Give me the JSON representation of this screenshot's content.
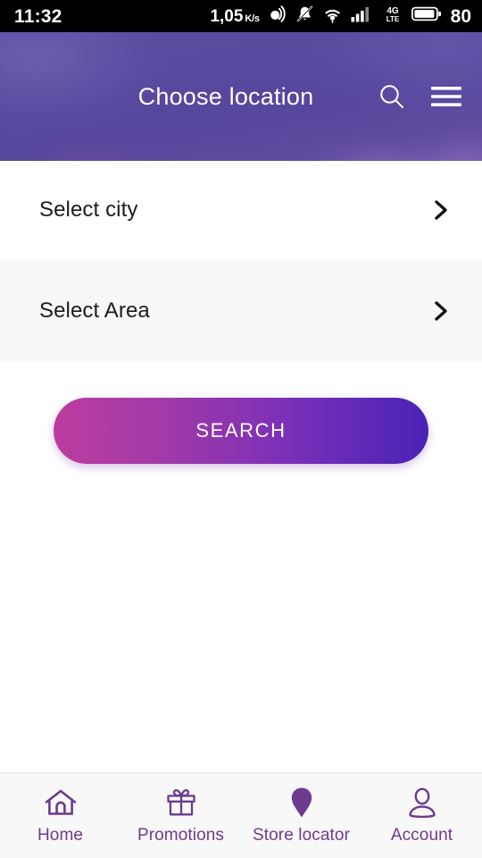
{
  "statusbar": {
    "time": "11:32",
    "network_speed_value": "1,05",
    "network_speed_unit": "K/s",
    "sound_icon": "vibrate-icon",
    "mute_icon": "bell-muted-icon",
    "wifi_icon": "wifi-icon",
    "signal_icon": "cellular-signal-icon",
    "network_type": "4G",
    "network_type_sub": "LTE",
    "battery_icon": "battery-icon",
    "battery_percent": "80"
  },
  "header": {
    "title": "Choose location",
    "search_icon": "search-icon",
    "menu_icon": "hamburger-menu-icon"
  },
  "rows": [
    {
      "label": "Select city",
      "chevron": "chevron-right-icon"
    },
    {
      "label": "Select Area",
      "chevron": "chevron-right-icon"
    }
  ],
  "search_button": {
    "label": "SEARCH",
    "gradient_start": "#bc3c9f",
    "gradient_end": "#4a22b5"
  },
  "bottom_nav": {
    "active_index": 2,
    "accent_color": "#6d3b8e",
    "items": [
      {
        "label": "Home",
        "icon": "home-icon"
      },
      {
        "label": "Promotions",
        "icon": "gift-icon"
      },
      {
        "label": "Store locator",
        "icon": "map-pin-icon"
      },
      {
        "label": "Account",
        "icon": "person-icon"
      }
    ]
  }
}
